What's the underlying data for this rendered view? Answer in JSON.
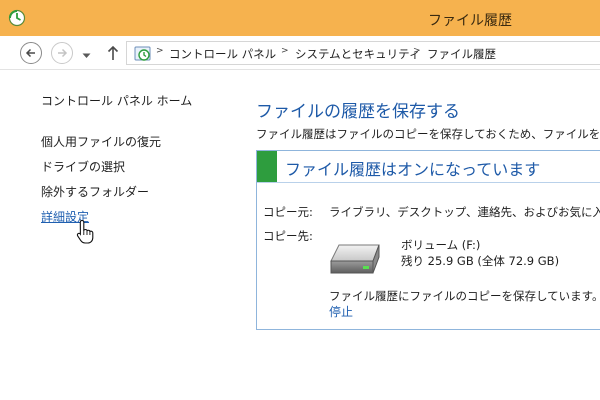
{
  "window": {
    "title": "ファイル履歴"
  },
  "address": {
    "crumbs": [
      "コントロール パネル",
      "システムとセキュリティ",
      "ファイル履歴"
    ],
    "separator": ">"
  },
  "sidebar": {
    "home": "コントロール パネル ホーム",
    "links": [
      "個人用ファイルの復元",
      "ドライブの選択",
      "除外するフォルダー",
      "詳細設定"
    ]
  },
  "main": {
    "title": "ファイルの履歴を保存する",
    "description": "ファイル履歴はファイルのコピーを保存しておくため、ファイルを紛失ま",
    "panel": {
      "status_title": "ファイル履歴はオンになっています",
      "status_color": "#2e9d3e",
      "source_label": "コピー元:",
      "source_value": "ライブラリ、デスクトップ、連絡先、およびお気に入り",
      "dest_label": "コピー先:",
      "drive_name": "ボリューム (F:)",
      "drive_space": "残り 25.9 GB (全体 72.9 GB)",
      "saving_status": "ファイル履歴にファイルのコピーを保存しています。",
      "stop_link": "停止"
    }
  },
  "colors": {
    "titlebar": "#f6b24e",
    "link": "#1f5fb0",
    "heading": "#1e5aa8",
    "panel_border": "#8fb5dc"
  },
  "icons": [
    "file-history-icon",
    "back-arrow-icon",
    "forward-arrow-icon",
    "recent-locations-icon",
    "up-arrow-icon",
    "drive-icon",
    "hand-cursor-icon"
  ]
}
